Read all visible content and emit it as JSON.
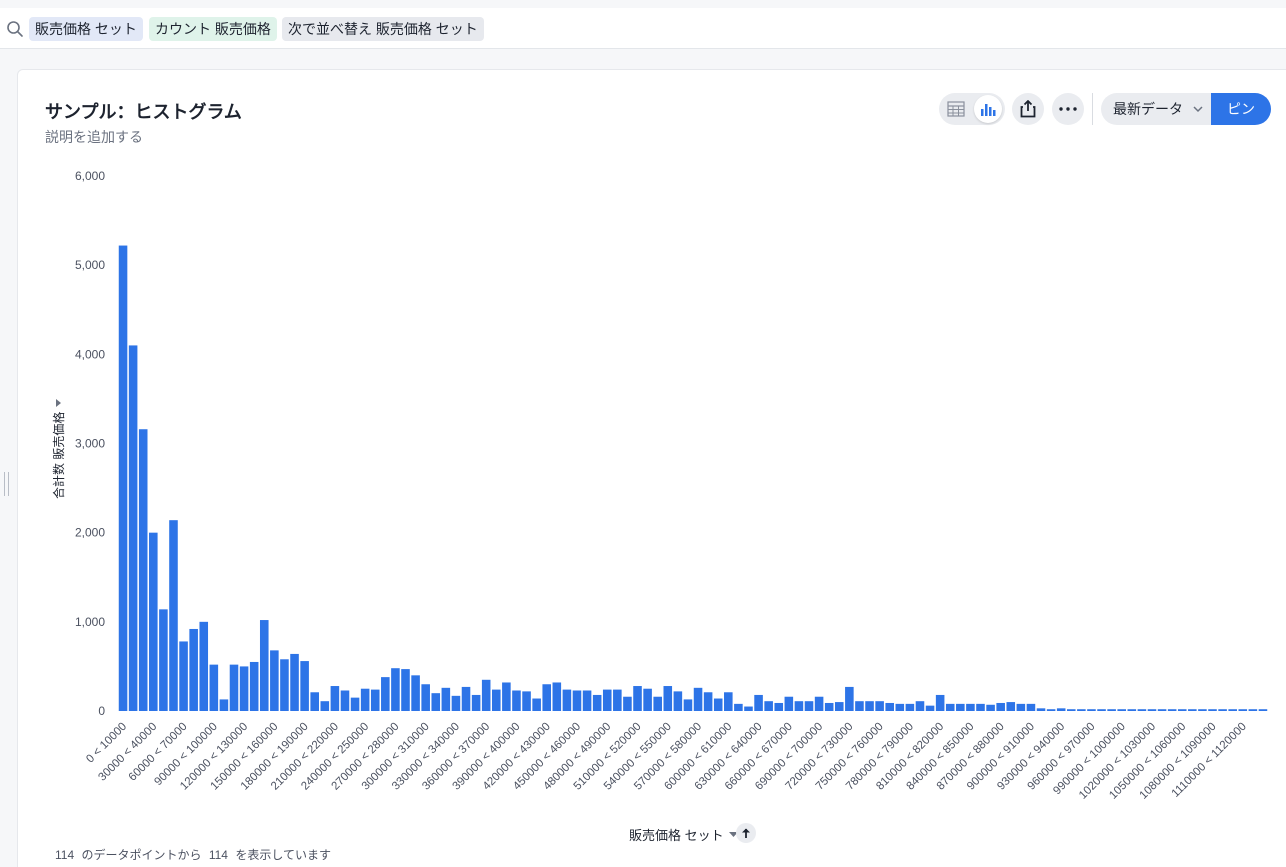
{
  "search": {
    "tokens": [
      "販売価格 セット",
      "カウント 販売価格",
      "次で並べ替え 販売価格 セット"
    ]
  },
  "header": {
    "title": "サンプル：ヒストグラム",
    "subtitle": "説明を追加する",
    "data_select_label": "最新データ",
    "pin_label": "ピン"
  },
  "footer": {
    "shown_count": "114",
    "middle_text": "のデータポイントから",
    "total_count": "114",
    "end_text": "を表示しています"
  },
  "colors": {
    "bar": "#2d74e7",
    "accent": "#2d74e7"
  },
  "chart_data": {
    "type": "bar",
    "title": "サンプル：ヒストグラム",
    "xlabel": "販売価格 セット",
    "ylabel": "合計数 販売価格",
    "ylim": [
      0,
      6000
    ],
    "yticks": [
      0,
      1000,
      2000,
      3000,
      4000,
      5000,
      6000
    ],
    "ytick_labels": [
      "0",
      "1,000",
      "2,000",
      "3,000",
      "4,000",
      "5,000",
      "6,000"
    ],
    "bin_width": 10000,
    "categories": [
      "0 < 10000",
      "10000 < 20000",
      "20000 < 30000",
      "30000 < 40000",
      "40000 < 50000",
      "50000 < 60000",
      "60000 < 70000",
      "70000 < 80000",
      "80000 < 90000",
      "90000 < 100000",
      "100000 < 110000",
      "110000 < 120000",
      "120000 < 130000",
      "130000 < 140000",
      "140000 < 150000",
      "150000 < 160000",
      "160000 < 170000",
      "170000 < 180000",
      "180000 < 190000",
      "190000 < 200000",
      "200000 < 210000",
      "210000 < 220000",
      "220000 < 230000",
      "230000 < 240000",
      "240000 < 250000",
      "250000 < 260000",
      "260000 < 270000",
      "270000 < 280000",
      "280000 < 290000",
      "290000 < 300000",
      "300000 < 310000",
      "310000 < 320000",
      "320000 < 330000",
      "330000 < 340000",
      "340000 < 350000",
      "350000 < 360000",
      "360000 < 370000",
      "370000 < 380000",
      "380000 < 390000",
      "390000 < 400000",
      "400000 < 410000",
      "410000 < 420000",
      "420000 < 430000",
      "430000 < 440000",
      "440000 < 450000",
      "450000 < 460000",
      "460000 < 470000",
      "470000 < 480000",
      "480000 < 490000",
      "490000 < 500000",
      "500000 < 510000",
      "510000 < 520000",
      "520000 < 530000",
      "530000 < 540000",
      "540000 < 550000",
      "550000 < 560000",
      "560000 < 570000",
      "570000 < 580000",
      "580000 < 590000",
      "590000 < 600000",
      "600000 < 610000",
      "610000 < 620000",
      "620000 < 630000",
      "630000 < 640000",
      "640000 < 650000",
      "650000 < 660000",
      "660000 < 670000",
      "670000 < 680000",
      "680000 < 690000",
      "690000 < 700000",
      "700000 < 710000",
      "710000 < 720000",
      "720000 < 730000",
      "730000 < 740000",
      "740000 < 750000",
      "750000 < 760000",
      "760000 < 770000",
      "770000 < 780000",
      "780000 < 790000",
      "790000 < 800000",
      "800000 < 810000",
      "810000 < 820000",
      "820000 < 830000",
      "830000 < 840000",
      "840000 < 850000",
      "850000 < 860000",
      "860000 < 870000",
      "870000 < 880000",
      "880000 < 890000",
      "890000 < 900000",
      "900000 < 910000",
      "910000 < 920000",
      "920000 < 930000",
      "930000 < 940000",
      "940000 < 950000",
      "950000 < 960000",
      "960000 < 970000",
      "970000 < 980000",
      "980000 < 990000",
      "990000 < 1000000",
      "1000000 < 1010000",
      "1010000 < 1020000",
      "1020000 < 1030000",
      "1030000 < 1040000",
      "1040000 < 1050000",
      "1050000 < 1060000",
      "1060000 < 1070000",
      "1070000 < 1080000",
      "1080000 < 1090000",
      "1090000 < 1100000",
      "1100000 < 1110000",
      "1110000 < 1120000",
      "1120000 < 1130000",
      "1130000 < 1140000"
    ],
    "values": [
      5220,
      4100,
      3160,
      2000,
      1140,
      2140,
      780,
      920,
      1000,
      520,
      130,
      520,
      500,
      550,
      1020,
      680,
      580,
      640,
      560,
      210,
      110,
      280,
      230,
      150,
      250,
      240,
      380,
      480,
      470,
      400,
      300,
      200,
      260,
      170,
      270,
      180,
      350,
      240,
      320,
      230,
      220,
      140,
      300,
      320,
      240,
      230,
      230,
      180,
      240,
      240,
      160,
      280,
      250,
      160,
      280,
      220,
      130,
      260,
      210,
      140,
      210,
      80,
      50,
      180,
      110,
      90,
      160,
      110,
      110,
      160,
      90,
      100,
      270,
      110,
      110,
      110,
      90,
      80,
      80,
      110,
      60,
      180,
      80,
      80,
      80,
      80,
      70,
      90,
      100,
      80,
      80,
      30,
      20,
      30,
      20,
      20,
      20,
      20,
      20,
      20,
      20,
      20,
      20,
      20,
      20,
      20,
      20,
      20,
      20,
      20,
      20,
      20,
      20,
      20
    ],
    "tick_every": 3,
    "grid": false,
    "legend": "none"
  }
}
